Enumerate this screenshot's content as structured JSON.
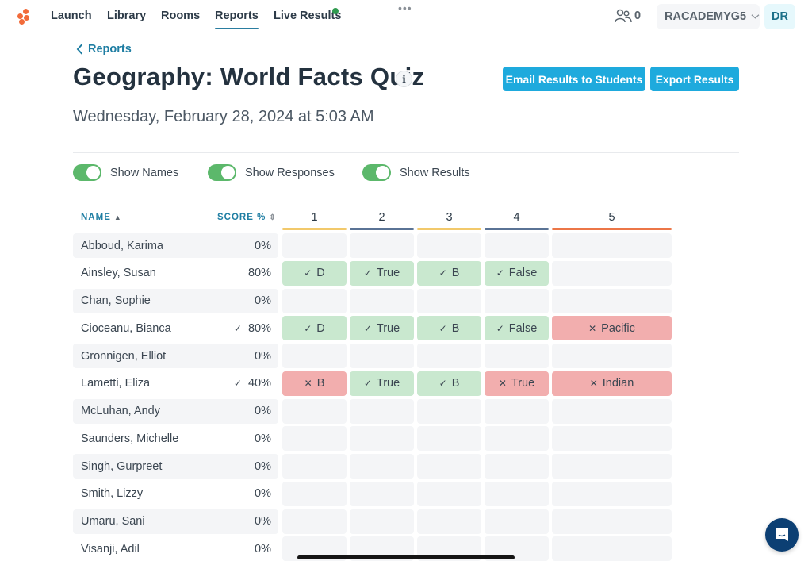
{
  "nav": {
    "items": [
      {
        "label": "Launch",
        "active": false
      },
      {
        "label": "Library",
        "active": false
      },
      {
        "label": "Rooms",
        "active": false
      },
      {
        "label": "Reports",
        "active": true
      },
      {
        "label": "Live Results",
        "active": false,
        "indicator": "green-dot"
      }
    ],
    "more_icon": "ellipsis-icon",
    "student_count": "0",
    "class_name": "RACADEMYG5",
    "avatar_initials": "DR"
  },
  "header": {
    "back_label": "Reports",
    "title": "Geography: World Facts Quiz",
    "info_icon": "i",
    "email_button": "Email Results to Students",
    "export_button": "Export Results",
    "date": "Wednesday, February 28, 2024 at 5:03 AM"
  },
  "toggles": [
    {
      "label": "Show Names",
      "on": true
    },
    {
      "label": "Show Responses",
      "on": true
    },
    {
      "label": "Show Results",
      "on": true
    }
  ],
  "table": {
    "name_header": "NAME",
    "name_sort": "▲",
    "score_header": "SCORE %",
    "score_sort": "⇕",
    "questions": [
      {
        "label": "1",
        "color": "#f2c96b"
      },
      {
        "label": "2",
        "color": "#5a7395"
      },
      {
        "label": "3",
        "color": "#f2c96b"
      },
      {
        "label": "4",
        "color": "#5a7395"
      },
      {
        "label": "5",
        "color": "#ec7647"
      }
    ],
    "rows": [
      {
        "name": "Abboud, Karima",
        "score": "0%",
        "scored_check": false,
        "responses": [
          null,
          null,
          null,
          null,
          null
        ]
      },
      {
        "name": "Ainsley, Susan",
        "score": "80%",
        "scored_check": false,
        "responses": [
          {
            "answer": "D",
            "correct": true
          },
          {
            "answer": "True",
            "correct": true
          },
          {
            "answer": "B",
            "correct": true
          },
          {
            "answer": "False",
            "correct": true
          },
          null
        ]
      },
      {
        "name": "Chan, Sophie",
        "score": "0%",
        "scored_check": false,
        "responses": [
          null,
          null,
          null,
          null,
          null
        ]
      },
      {
        "name": "Cioceanu, Bianca",
        "score": "80%",
        "scored_check": true,
        "responses": [
          {
            "answer": "D",
            "correct": true
          },
          {
            "answer": "True",
            "correct": true
          },
          {
            "answer": "B",
            "correct": true
          },
          {
            "answer": "False",
            "correct": true
          },
          {
            "answer": "Pacific",
            "correct": false
          }
        ]
      },
      {
        "name": "Gronnigen, Elliot",
        "score": "0%",
        "scored_check": false,
        "responses": [
          null,
          null,
          null,
          null,
          null
        ]
      },
      {
        "name": "Lametti, Eliza",
        "score": "40%",
        "scored_check": true,
        "responses": [
          {
            "answer": "B",
            "correct": false
          },
          {
            "answer": "True",
            "correct": true
          },
          {
            "answer": "B",
            "correct": true
          },
          {
            "answer": "True",
            "correct": false
          },
          {
            "answer": "Indian",
            "correct": false
          }
        ]
      },
      {
        "name": "McLuhan, Andy",
        "score": "0%",
        "scored_check": false,
        "responses": [
          null,
          null,
          null,
          null,
          null
        ]
      },
      {
        "name": "Saunders, Michelle",
        "score": "0%",
        "scored_check": false,
        "responses": [
          null,
          null,
          null,
          null,
          null
        ]
      },
      {
        "name": "Singh, Gurpreet",
        "score": "0%",
        "scored_check": false,
        "responses": [
          null,
          null,
          null,
          null,
          null
        ]
      },
      {
        "name": "Smith, Lizzy",
        "score": "0%",
        "scored_check": false,
        "responses": [
          null,
          null,
          null,
          null,
          null
        ]
      },
      {
        "name": "Umaru, Sani",
        "score": "0%",
        "scored_check": false,
        "responses": [
          null,
          null,
          null,
          null,
          null
        ]
      },
      {
        "name": "Visanji, Adil",
        "score": "0%",
        "scored_check": false,
        "responses": [
          null,
          null,
          null,
          null,
          null
        ]
      }
    ],
    "correct_mark": "✓",
    "wrong_mark": "✕"
  },
  "colors": {
    "accent": "#1eaadd",
    "link": "#1f7ea3",
    "toggle_on": "#5cb86b",
    "correct_bg": "#c9e8cf",
    "wrong_bg": "#f2aeae",
    "logo": "#f26b3a",
    "chat": "#0c3f73"
  }
}
